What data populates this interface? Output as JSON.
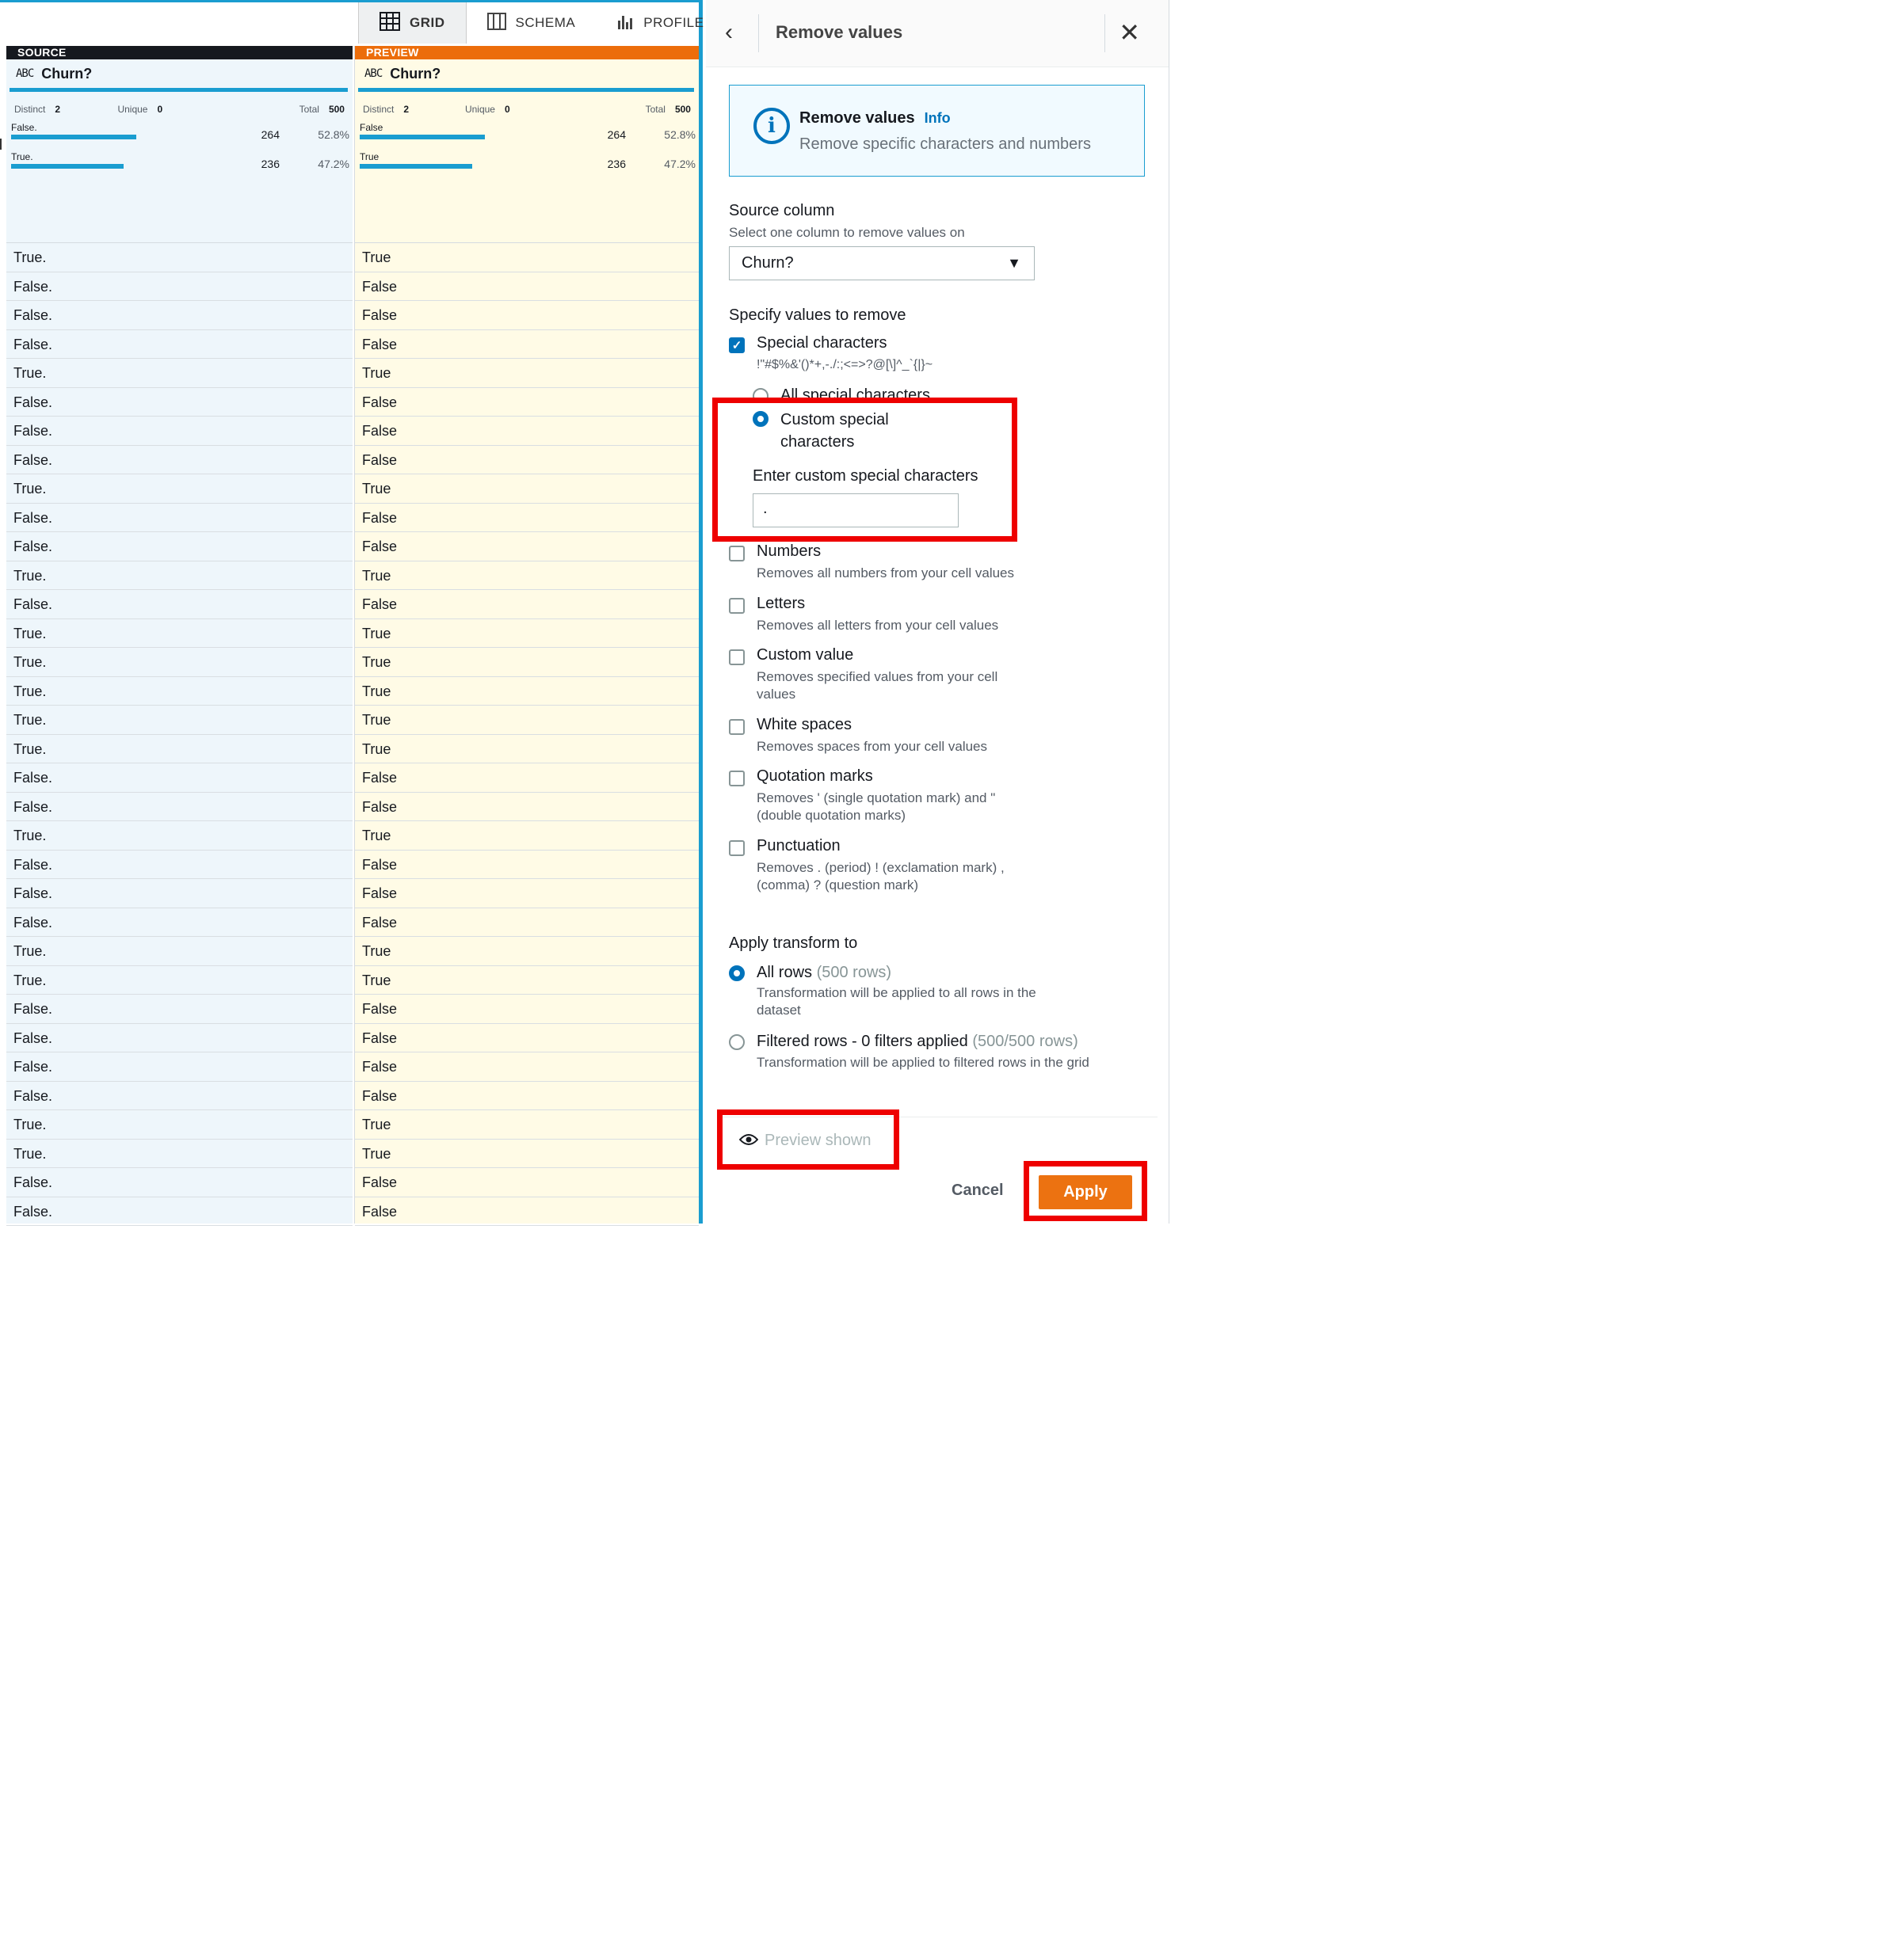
{
  "tabs": [
    {
      "label": "GRID",
      "icon": "grid-icon",
      "active": true
    },
    {
      "label": "SCHEMA",
      "icon": "schema-icon",
      "active": false
    },
    {
      "label": "PROFILE",
      "icon": "profile-icon",
      "active": false
    }
  ],
  "source": {
    "label": "SOURCE",
    "type": "ABC",
    "column": "Churn?",
    "distinct_label": "Distinct",
    "distinct": "2",
    "unique_label": "Unique",
    "unique": "0",
    "total_label": "Total",
    "total": "500",
    "buckets": [
      {
        "name": "False.",
        "count": "264",
        "pct": "52.8%"
      },
      {
        "name": "True.",
        "count": "236",
        "pct": "47.2%"
      }
    ],
    "rows": [
      "True.",
      "False.",
      "False.",
      "False.",
      "True.",
      "False.",
      "False.",
      "False.",
      "True.",
      "False.",
      "False.",
      "True.",
      "False.",
      "True.",
      "True.",
      "True.",
      "True.",
      "True.",
      "False.",
      "False.",
      "True.",
      "False.",
      "False.",
      "False.",
      "True.",
      "True.",
      "False.",
      "False.",
      "False.",
      "False.",
      "True.",
      "True.",
      "False.",
      "False."
    ]
  },
  "preview": {
    "label": "PREVIEW",
    "type": "ABC",
    "column": "Churn?",
    "distinct_label": "Distinct",
    "distinct": "2",
    "unique_label": "Unique",
    "unique": "0",
    "total_label": "Total",
    "total": "500",
    "buckets": [
      {
        "name": "False",
        "count": "264",
        "pct": "52.8%"
      },
      {
        "name": "True",
        "count": "236",
        "pct": "47.2%"
      }
    ],
    "rows": [
      "True",
      "False",
      "False",
      "False",
      "True",
      "False",
      "False",
      "False",
      "True",
      "False",
      "False",
      "True",
      "False",
      "True",
      "True",
      "True",
      "True",
      "True",
      "False",
      "False",
      "True",
      "False",
      "False",
      "False",
      "True",
      "True",
      "False",
      "False",
      "False",
      "False",
      "True",
      "True",
      "False",
      "False"
    ]
  },
  "panel": {
    "title": "Remove values",
    "info_title": "Remove values",
    "info_link": "Info",
    "info_desc": "Remove specific characters and numbers",
    "source_label": "Source column",
    "source_desc": "Select one column to remove values on",
    "source_value": "Churn?",
    "specify_label": "Specify values to remove",
    "special": {
      "label": "Special characters",
      "chars": "!\"#$%&'()*+,-./:;<=>?@[\\]^_`{|}~",
      "checked": true
    },
    "all_special": "All special characters",
    "custom_special": "Custom special characters",
    "custom_input_label": "Enter custom special characters",
    "custom_input_value": ".",
    "options": [
      {
        "label": "Numbers",
        "desc": "Removes all numbers from your cell values"
      },
      {
        "label": "Letters",
        "desc": "Removes all letters from your cell values"
      },
      {
        "label": "Custom value",
        "desc": "Removes specified values from your cell values"
      },
      {
        "label": "White spaces",
        "desc": "Removes spaces from your cell values"
      },
      {
        "label": "Quotation marks",
        "desc": "Removes ' (single quotation mark) and \" (double quotation marks)"
      },
      {
        "label": "Punctuation",
        "desc": "Removes . (period) ! (exclamation mark) , (comma) ? (question mark)"
      }
    ],
    "apply_to_label": "Apply transform to",
    "all_rows": "All rows",
    "all_rows_count": "(500 rows)",
    "all_rows_desc": "Transformation will be applied to all rows in the dataset",
    "filtered_rows": "Filtered rows - 0 filters applied",
    "filtered_rows_count": "(500/500 rows)",
    "filtered_rows_desc": "Transformation will be applied to filtered rows in the grid",
    "preview_label": "Preview shown",
    "cancel_label": "Cancel",
    "apply_label": "Apply"
  },
  "colors": {
    "accent": "#1a9dd0",
    "preview_header": "#ec6d0b",
    "apply": "#ec7211",
    "highlight": "#ee0000"
  }
}
